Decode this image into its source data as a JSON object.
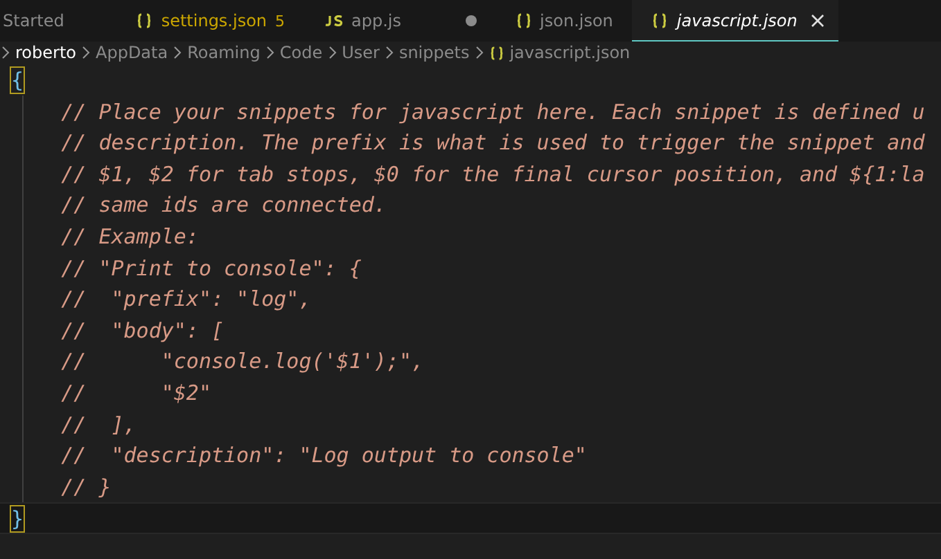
{
  "tabs": [
    {
      "label": "Started",
      "kind": "plain",
      "selected": false,
      "modified": false,
      "warning": false
    },
    {
      "label": "settings.json",
      "kind": "json",
      "badge": "5",
      "selected": false,
      "modified": false,
      "warning": true
    },
    {
      "label": "app.js",
      "kind": "js",
      "selected": false,
      "modified": true,
      "warning": false
    },
    {
      "label": "json.json",
      "kind": "json",
      "selected": false,
      "modified": false,
      "warning": false
    },
    {
      "label": "javascript.json",
      "kind": "json",
      "selected": true,
      "modified": false,
      "warning": false
    }
  ],
  "breadcrumb": [
    {
      "label": "roberto",
      "kind": "folder",
      "highlighted": true
    },
    {
      "label": "AppData",
      "kind": "folder",
      "highlighted": false
    },
    {
      "label": "Roaming",
      "kind": "folder",
      "highlighted": false
    },
    {
      "label": "Code",
      "kind": "folder",
      "highlighted": false
    },
    {
      "label": "User",
      "kind": "folder",
      "highlighted": false
    },
    {
      "label": "snippets",
      "kind": "folder",
      "highlighted": false
    },
    {
      "label": "javascript.json",
      "kind": "json",
      "highlighted": false
    }
  ],
  "code": [
    {
      "kind": "bracket",
      "text": "{",
      "current": false
    },
    {
      "kind": "comment",
      "text": "    // Place your snippets for javascript here. Each snippet is defined u",
      "current": false
    },
    {
      "kind": "comment",
      "text": "    // description. The prefix is what is used to trigger the snippet and",
      "current": false
    },
    {
      "kind": "comment",
      "text": "    // $1, $2 for tab stops, $0 for the final cursor position, and ${1:la",
      "current": false
    },
    {
      "kind": "comment",
      "text": "    // same ids are connected.",
      "current": false
    },
    {
      "kind": "comment",
      "text": "    // Example:",
      "current": false
    },
    {
      "kind": "comment",
      "text": "    // \"Print to console\": {",
      "current": false
    },
    {
      "kind": "comment",
      "text": "    //  \"prefix\": \"log\",",
      "current": false
    },
    {
      "kind": "comment",
      "text": "    //  \"body\": [",
      "current": false
    },
    {
      "kind": "comment",
      "text": "    //      \"console.log('$1');\",",
      "current": false
    },
    {
      "kind": "comment",
      "text": "    //      \"$2\"",
      "current": false
    },
    {
      "kind": "comment",
      "text": "    //  ],",
      "current": false
    },
    {
      "kind": "comment",
      "text": "    //  \"description\": \"Log output to console\"",
      "current": false
    },
    {
      "kind": "comment",
      "text": "    // }",
      "current": false
    },
    {
      "kind": "bracket",
      "text": "}",
      "current": true
    }
  ]
}
